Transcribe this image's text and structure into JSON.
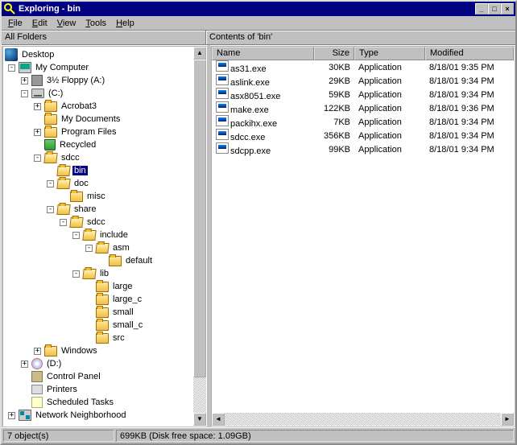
{
  "window": {
    "title": "Exploring - bin"
  },
  "menu": {
    "file": "File",
    "edit": "Edit",
    "view": "View",
    "tools": "Tools",
    "help": "Help"
  },
  "labels": {
    "left": "All Folders",
    "right": "Contents of 'bin'"
  },
  "tree": {
    "desktop": "Desktop",
    "my_computer": "My Computer",
    "floppy": "3½ Floppy (A:)",
    "c_drive": "(C:)",
    "acrobat3": "Acrobat3",
    "my_documents": "My Documents",
    "program_files": "Program Files",
    "recycled": "Recycled",
    "sdcc": "sdcc",
    "bin": "bin",
    "doc": "doc",
    "misc": "misc",
    "share": "share",
    "sdcc2": "sdcc",
    "include": "include",
    "asm": "asm",
    "default": "default",
    "lib": "lib",
    "large": "large",
    "large_c": "large_c",
    "small": "small",
    "small_c": "small_c",
    "src": "src",
    "windows": "Windows",
    "d_drive": "(D:)",
    "control_panel": "Control Panel",
    "printers": "Printers",
    "scheduled_tasks": "Scheduled Tasks",
    "network": "Network Neighborhood"
  },
  "columns": {
    "name": "Name",
    "size": "Size",
    "type": "Type",
    "modified": "Modified"
  },
  "files": [
    {
      "name": "as31.exe",
      "size": "30KB",
      "type": "Application",
      "modified": "8/18/01 9:35 PM"
    },
    {
      "name": "aslink.exe",
      "size": "29KB",
      "type": "Application",
      "modified": "8/18/01 9:34 PM"
    },
    {
      "name": "asx8051.exe",
      "size": "59KB",
      "type": "Application",
      "modified": "8/18/01 9:34 PM"
    },
    {
      "name": "make.exe",
      "size": "122KB",
      "type": "Application",
      "modified": "8/18/01 9:36 PM"
    },
    {
      "name": "packihx.exe",
      "size": "7KB",
      "type": "Application",
      "modified": "8/18/01 9:34 PM"
    },
    {
      "name": "sdcc.exe",
      "size": "356KB",
      "type": "Application",
      "modified": "8/18/01 9:34 PM"
    },
    {
      "name": "sdcpp.exe",
      "size": "99KB",
      "type": "Application",
      "modified": "8/18/01 9:34 PM"
    }
  ],
  "status": {
    "objects": "7 object(s)",
    "size": "699KB (Disk free space: 1.09GB)"
  }
}
